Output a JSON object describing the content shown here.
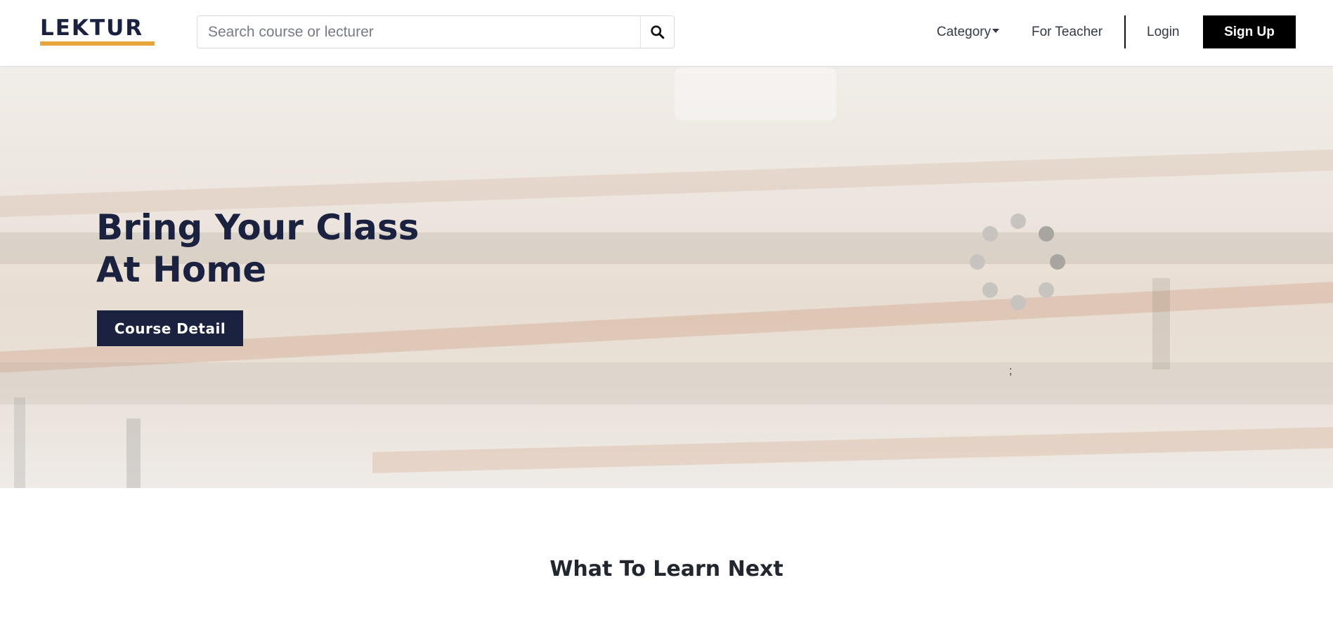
{
  "brand": {
    "logo_text": "LEKTUR",
    "accent_color": "#e8a53a",
    "primary_color": "#1a2240"
  },
  "search": {
    "placeholder": "Search course or lecturer",
    "value": "",
    "icon": "search-icon"
  },
  "nav": {
    "category_label": "Category",
    "teacher_label": "For Teacher",
    "login_label": "Login",
    "signup_label": "Sign Up"
  },
  "hero": {
    "title_line1": "Bring Your Class",
    "title_line2": "At Home",
    "button_label": "Course Detail",
    "loading_indicator": "loading-spinner-icon",
    "stray_text": ";"
  },
  "section": {
    "title": "What To Learn Next"
  }
}
